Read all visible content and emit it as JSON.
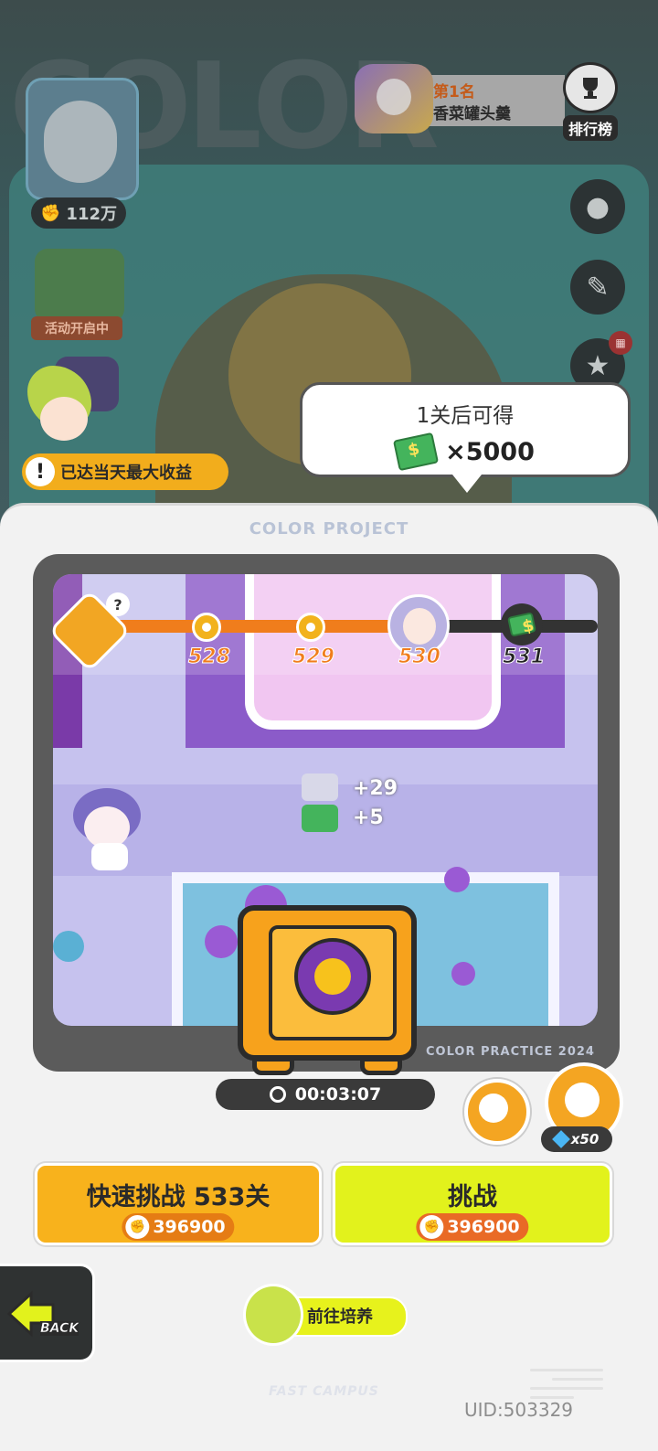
{
  "profile": {
    "power": "112万",
    "event_label": "活动开启中"
  },
  "ranking": {
    "rank_label": "第1名",
    "player_name": "香菜罐头羹",
    "button_label": "排行榜"
  },
  "reward_bubble": {
    "title": "1关后可得",
    "reward": "×5000"
  },
  "notice": {
    "max_income": "已达当天最大收益"
  },
  "panel": {
    "header": "COLOR PROJECT",
    "watermark": "COLOR PRACTICE 2024",
    "footer_mark": "FAST CAMPUS",
    "uid": "UID:503329"
  },
  "progress": {
    "levels": [
      "528",
      "529",
      "530",
      "531"
    ],
    "current_level": "530",
    "fill_fraction": 0.66
  },
  "gains": {
    "paint": "+29",
    "cash": "+5"
  },
  "timer": "00:03:07",
  "boost": {
    "cost": "x50"
  },
  "buttons": {
    "quick_challenge": {
      "label": "快速挑战 533关",
      "cost": "396900"
    },
    "challenge": {
      "label": "挑战",
      "cost": "396900"
    },
    "train": "前往培养",
    "back": "BACK"
  },
  "icons": [
    "fist-icon",
    "cash-icon",
    "chest-icon",
    "clock-icon",
    "alarm-clock-icon",
    "diamond-icon",
    "back-arrow-icon",
    "trophy-icon",
    "warning-icon"
  ],
  "colors": {
    "accent_orange": "#f8b21c",
    "accent_lime": "#e2f21c",
    "progress": "#f07d1c",
    "cost_pill": "#e57c14"
  }
}
